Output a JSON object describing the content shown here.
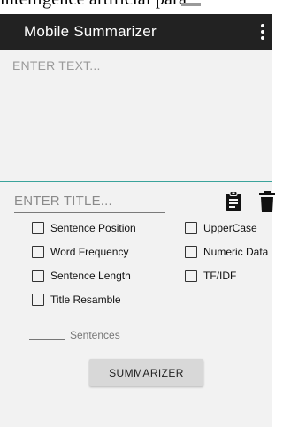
{
  "top_strip": {
    "text": "intelligence artificial para"
  },
  "app_bar": {
    "title": "Mobile Summarizer",
    "overflow_icon": "more-vert-icon",
    "background": "#222222"
  },
  "text_input": {
    "placeholder": "ENTER TEXT...",
    "value": "",
    "underline_color": "#3aa39b"
  },
  "title_input": {
    "placeholder": "ENTER TITLE...",
    "value": ""
  },
  "actions": {
    "paste_icon": "clipboard-icon",
    "clear_icon": "trash-icon"
  },
  "options": {
    "sentence_position": {
      "label": "Sentence Position",
      "checked": false
    },
    "word_frequency": {
      "label": "Word Frequency",
      "checked": false
    },
    "sentence_length": {
      "label": "Sentence Length",
      "checked": false
    },
    "title_resamble": {
      "label": "Title Resamble",
      "checked": false
    },
    "uppercase": {
      "label": "UpperCase",
      "checked": false
    },
    "numeric_data": {
      "label": "Numeric Data",
      "checked": false
    },
    "tf_idf": {
      "label": "TF/IDF",
      "checked": false
    }
  },
  "sentences": {
    "label": "Sentences",
    "value": ""
  },
  "summarize_button": {
    "label": "SUMMARIZER"
  }
}
